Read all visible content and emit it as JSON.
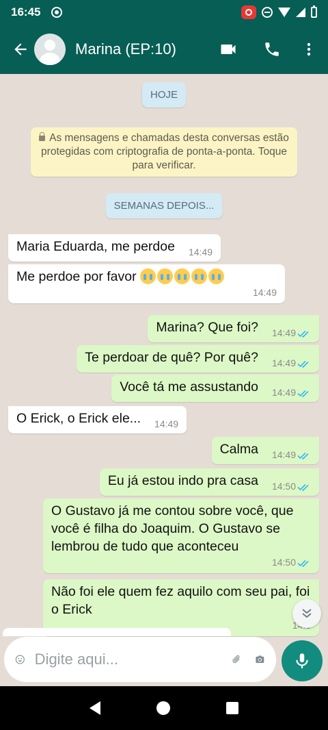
{
  "status_bar": {
    "time": "16:45"
  },
  "header": {
    "contact_name": "Marina (EP:10)"
  },
  "chat": {
    "date_chip": "HOJE",
    "encryption_notice": "As mensagens e chamadas desta conversas estão protegidas com criptografia de ponta-a-ponta. Toque para verificar.",
    "chapter_chip": "SEMANAS DEPOIS...",
    "messages": [
      {
        "direction": "in",
        "text": "Maria Eduarda, me perdoe",
        "time": "14:49"
      },
      {
        "direction": "in",
        "text": "Me perdoe por favor",
        "emoji": "😭😭😭😭😭",
        "time": "14:49"
      },
      {
        "direction": "out",
        "text": "Marina? Que foi?",
        "time": "14:49",
        "status": "read"
      },
      {
        "direction": "out",
        "text": "Te perdoar de quê? Por quê?",
        "time": "14:49",
        "status": "read"
      },
      {
        "direction": "out",
        "text": "Você tá me assustando",
        "time": "14:49",
        "status": "read"
      },
      {
        "direction": "in",
        "text": "O Erick, o Erick ele...",
        "time": "14:49"
      },
      {
        "direction": "out",
        "text": "Calma",
        "time": "14:49",
        "status": "read"
      },
      {
        "direction": "out",
        "text": "Eu já estou indo pra casa",
        "time": "14:50",
        "status": "read"
      },
      {
        "direction": "out",
        "text": "O Gustavo já me contou sobre você, que você é filha do Joaquim. O Gustavo se lembrou de tudo que aconteceu",
        "time": "14:50",
        "status": "read"
      },
      {
        "direction": "out",
        "text": "Não foi ele quem fez aquilo com seu pai, foi o Erick",
        "time": "14:5"
      }
    ]
  },
  "composer": {
    "placeholder": "Digite aqui..."
  },
  "colors": {
    "header": "#075E54",
    "outgoing_bubble": "#dcf8c6",
    "incoming_bubble": "#ffffff",
    "read_tick": "#34b7f1",
    "mic_button": "#128C7E"
  }
}
